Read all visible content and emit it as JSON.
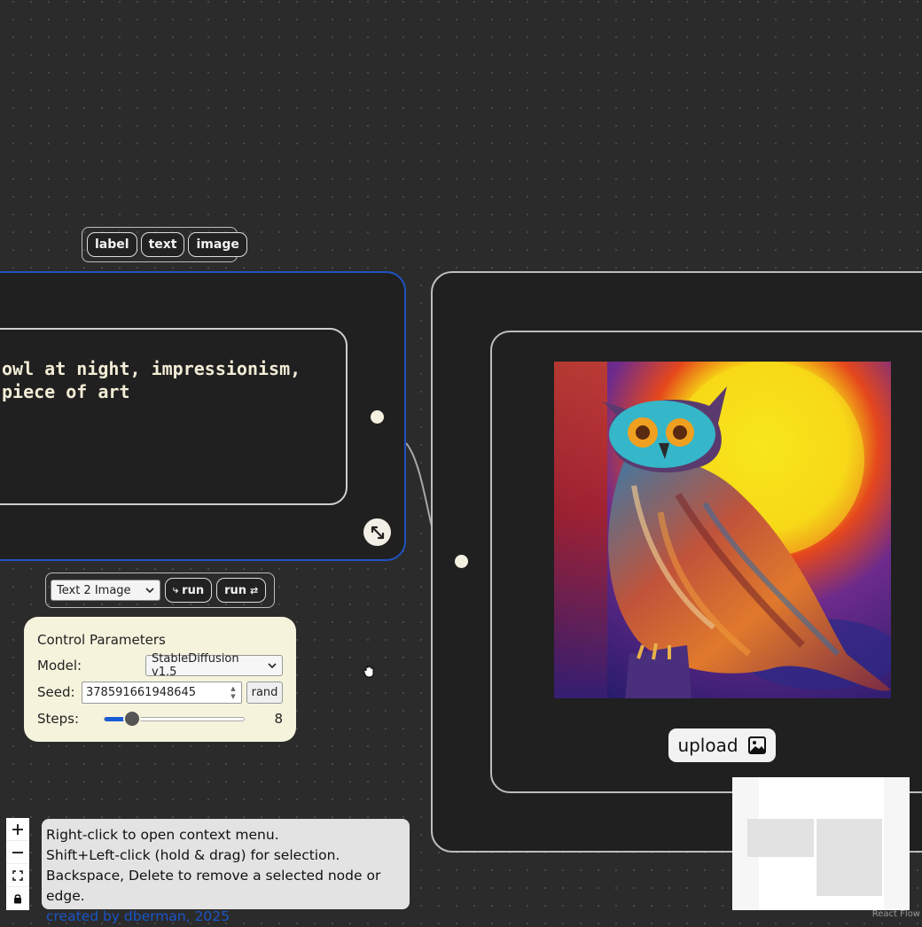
{
  "node_toolbar": {
    "buttons": [
      "label",
      "text",
      "image"
    ]
  },
  "text_node": {
    "prompt": "owl at night, impressionism,\npiece of art"
  },
  "run_toolbar": {
    "mode_select_value": "Text 2 Image",
    "run_label": "run",
    "run_repeat_label": "run"
  },
  "control_parameters": {
    "title": "Control Parameters",
    "model_label": "Model:",
    "model_value": "StableDiffusion v1.5",
    "seed_label": "Seed:",
    "seed_value": "378591661948645",
    "rand_label": "rand",
    "steps_label": "Steps:",
    "steps_value": "8",
    "steps_fraction": 0.2
  },
  "image_node": {
    "upload_label": "upload"
  },
  "help": {
    "line1": "Right-click to open context menu.",
    "line2": "Shift+Left-click (hold & drag) for selection.",
    "line3": "Backspace, Delete to remove a selected node or edge.",
    "credit": "created by dberman, 2025"
  },
  "attribution": "React Flow",
  "colors": {
    "canvas": "#2b2b2b",
    "selected_border": "#1f53c3",
    "params_bg": "#f5f3dc",
    "link": "#1b55c8"
  }
}
